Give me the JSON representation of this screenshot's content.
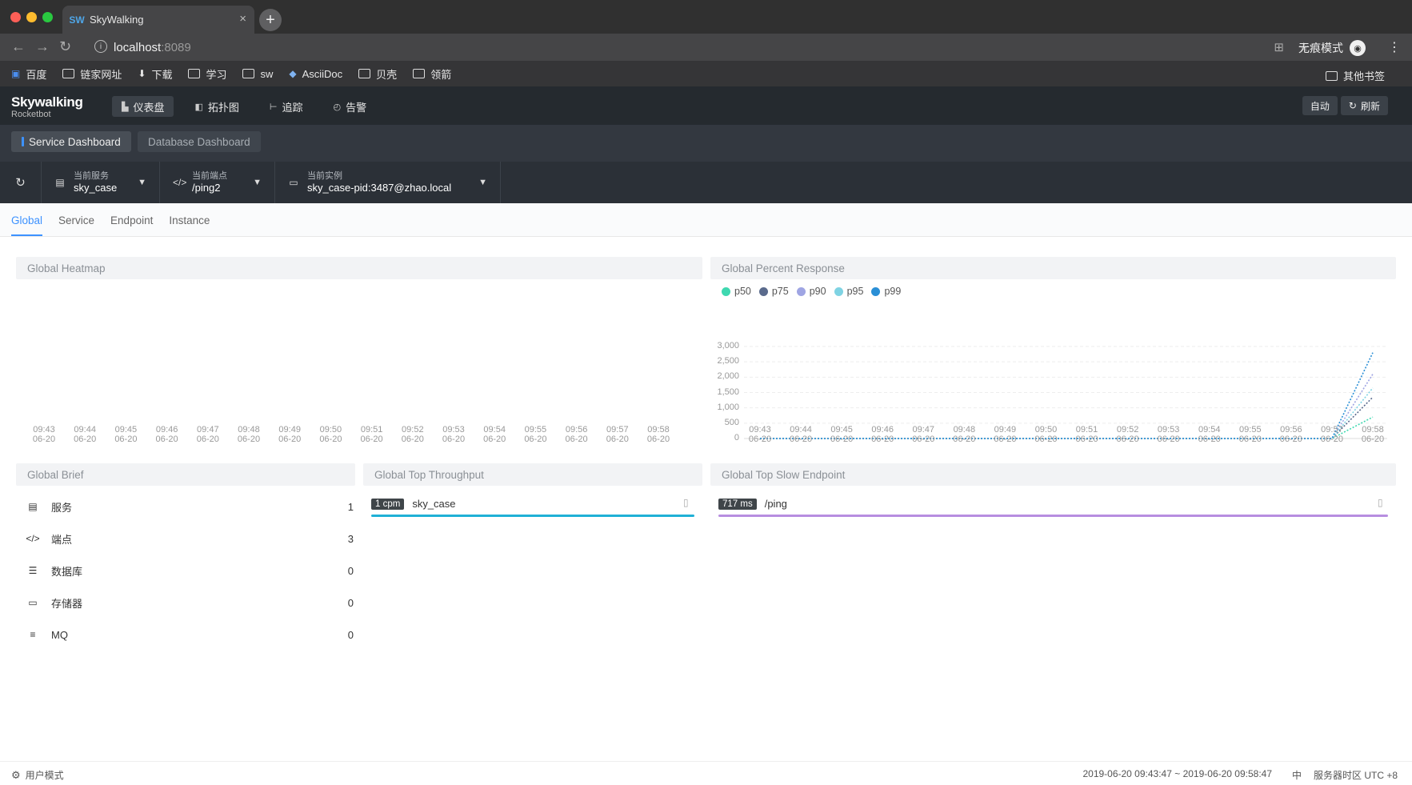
{
  "browser": {
    "tab_title": "SkyWalking",
    "favicon": "SW",
    "url_host": "localhost",
    "url_port": ":8089",
    "incognito_label": "无痕模式",
    "bookmarks": [
      "百度",
      "链家网址",
      "下载",
      "学习",
      "sw",
      "AsciiDoc",
      "贝壳",
      "领箭"
    ],
    "other_bookmarks": "其他书签"
  },
  "header": {
    "logo_title": "Skywalking",
    "logo_subtitle": "Rocketbot",
    "nav": [
      {
        "label": "仪表盘",
        "icon": "dashboard-icon"
      },
      {
        "label": "拓扑图",
        "icon": "topology-icon"
      },
      {
        "label": "追踪",
        "icon": "trace-icon"
      },
      {
        "label": "告警",
        "icon": "alarm-icon"
      }
    ],
    "auto_label": "自动",
    "refresh_label": "刷新"
  },
  "dashboards": [
    "Service Dashboard",
    "Database Dashboard"
  ],
  "selectors": {
    "service_label": "当前服务",
    "service_value": "sky_case",
    "endpoint_label": "当前端点",
    "endpoint_value": "/ping2",
    "instance_label": "当前实例",
    "instance_value": "sky_case-pid:3487@zhao.local"
  },
  "sub_tabs": [
    "Global",
    "Service",
    "Endpoint",
    "Instance"
  ],
  "panels": {
    "heatmap_title": "Global Heatmap",
    "percent_title": "Global Percent Response",
    "brief_title": "Global Brief",
    "throughput_title": "Global Top Throughput",
    "slow_title": "Global Top Slow Endpoint"
  },
  "chart_data": [
    {
      "type": "heatmap",
      "title": "Global Heatmap",
      "x": [
        "09:43\n06-20",
        "09:44\n06-20",
        "09:45\n06-20",
        "09:46\n06-20",
        "09:47\n06-20",
        "09:48\n06-20",
        "09:49\n06-20",
        "09:50\n06-20",
        "09:51\n06-20",
        "09:52\n06-20",
        "09:53\n06-20",
        "09:54\n06-20",
        "09:55\n06-20",
        "09:56\n06-20",
        "09:57\n06-20",
        "09:58\n06-20"
      ],
      "values": []
    },
    {
      "type": "line",
      "title": "Global Percent Response",
      "x": [
        "09:43\n06-20",
        "09:44\n06-20",
        "09:45\n06-20",
        "09:46\n06-20",
        "09:47\n06-20",
        "09:48\n06-20",
        "09:49\n06-20",
        "09:50\n06-20",
        "09:51\n06-20",
        "09:52\n06-20",
        "09:53\n06-20",
        "09:54\n06-20",
        "09:55\n06-20",
        "09:56\n06-20",
        "09:57\n06-20",
        "09:58\n06-20"
      ],
      "yticks": [
        "0",
        "500",
        "1,000",
        "1,500",
        "2,000",
        "2,500",
        "3,000"
      ],
      "ylim": [
        0,
        3000
      ],
      "grid": true,
      "legend_position": "top-left",
      "series": [
        {
          "name": "p50",
          "color": "#3fd8b0",
          "values": [
            0,
            0,
            0,
            0,
            0,
            0,
            0,
            0,
            0,
            0,
            0,
            0,
            0,
            0,
            0,
            700
          ]
        },
        {
          "name": "p75",
          "color": "#5a6a8c",
          "values": [
            0,
            0,
            0,
            0,
            0,
            0,
            0,
            0,
            0,
            0,
            0,
            0,
            0,
            0,
            0,
            1350
          ]
        },
        {
          "name": "p90",
          "color": "#9fa5e3",
          "values": [
            0,
            0,
            0,
            0,
            0,
            0,
            0,
            0,
            0,
            0,
            0,
            0,
            0,
            0,
            0,
            2100
          ]
        },
        {
          "name": "p95",
          "color": "#7fd3e3",
          "values": [
            0,
            0,
            0,
            0,
            0,
            0,
            0,
            0,
            0,
            0,
            0,
            0,
            0,
            0,
            0,
            1650
          ]
        },
        {
          "name": "p99",
          "color": "#2a8fd6",
          "values": [
            0,
            0,
            0,
            0,
            0,
            0,
            0,
            0,
            0,
            0,
            0,
            0,
            0,
            0,
            0,
            2800
          ]
        }
      ]
    }
  ],
  "brief": [
    {
      "label": "服务",
      "value": "1",
      "icon": "service-icon"
    },
    {
      "label": "端点",
      "value": "3",
      "icon": "endpoint-icon"
    },
    {
      "label": "数据库",
      "value": "0",
      "icon": "database-icon"
    },
    {
      "label": "存储器",
      "value": "0",
      "icon": "storage-icon"
    },
    {
      "label": "MQ",
      "value": "0",
      "icon": "mq-icon"
    }
  ],
  "throughput": {
    "badge": "1 cpm",
    "name": "sky_case",
    "color": "#1fb0d6",
    "fraction": 1.0
  },
  "slow": {
    "badge": "717 ms",
    "name": "/ping",
    "color": "#b78ee0",
    "fraction": 1.0
  },
  "footer": {
    "mode": "用户模式",
    "range": "2019-06-20 09:43:47 ~ 2019-06-20 09:58:47",
    "lang": "中",
    "timezone": "服务器时区 UTC +8"
  }
}
